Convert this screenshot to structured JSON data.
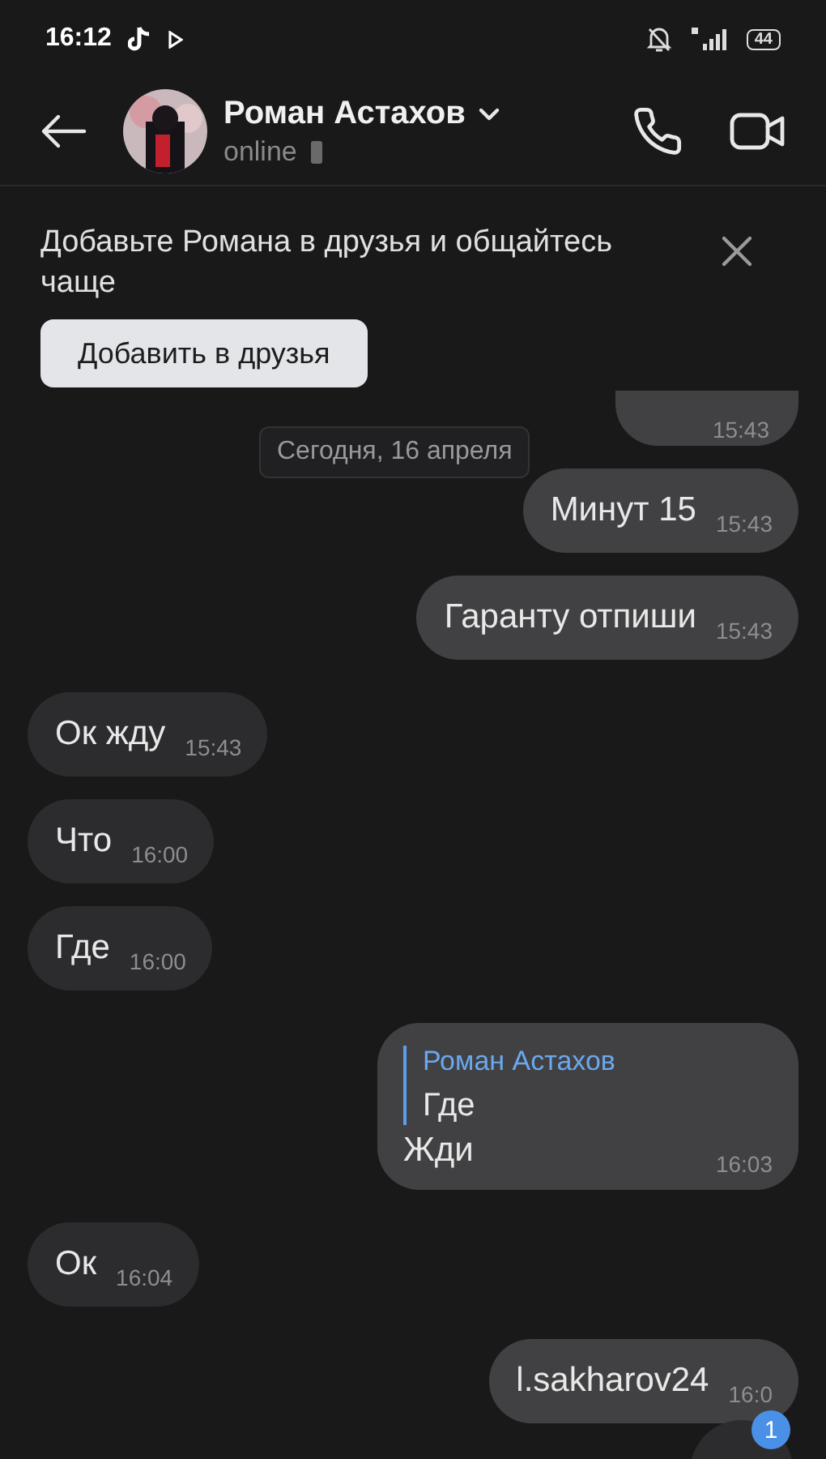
{
  "status_bar": {
    "time": "16:12",
    "battery": "44"
  },
  "header": {
    "name": "Роман Астахов",
    "status": "online"
  },
  "banner": {
    "text": "Добавьте Романа в друзья и общайтесь чаще",
    "button": "Добавить в друзья"
  },
  "date_chip": "Сегодня, 16 апреля",
  "messages": [
    {
      "kind": "cut",
      "outgoing": true,
      "time": "15:43"
    },
    {
      "kind": "text",
      "outgoing": true,
      "text": "Минут 15",
      "time": "15:43"
    },
    {
      "kind": "text",
      "outgoing": true,
      "text": "Гаранту отпиши",
      "time": "15:43"
    },
    {
      "kind": "text",
      "outgoing": false,
      "text": "Ок жду",
      "time": "15:43"
    },
    {
      "kind": "text",
      "outgoing": false,
      "text": "Что",
      "time": "16:00"
    },
    {
      "kind": "text",
      "outgoing": false,
      "text": "Где",
      "time": "16:00"
    },
    {
      "kind": "reply",
      "outgoing": true,
      "quote_author": "Роман Астахов",
      "quote_text": "Где",
      "text": "Жди",
      "time": "16:03"
    },
    {
      "kind": "text",
      "outgoing": false,
      "text": "Ок",
      "time": "16:04"
    },
    {
      "kind": "text",
      "outgoing": true,
      "text": "l.sakharov24",
      "time": "16:0"
    }
  ],
  "unread_badge": "1"
}
